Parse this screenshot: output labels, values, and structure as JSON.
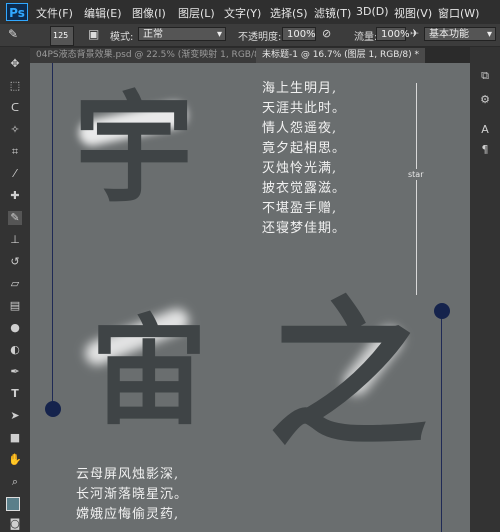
{
  "app": {
    "logo": "Ps"
  },
  "menu": [
    "文件(F)",
    "编辑(E)",
    "图像(I)",
    "图层(L)",
    "文字(Y)",
    "选择(S)",
    "滤镜(T)",
    "3D(D)",
    "视图(V)",
    "窗口(W)"
  ],
  "options": {
    "brush_size": "125",
    "mode_label": "模式:",
    "mode_value": "正常",
    "opacity_label": "不透明度:",
    "opacity_value": "100%",
    "flow_label": "流量:",
    "flow_value": "100%",
    "workspace": "基本功能"
  },
  "tabs": [
    {
      "label": "04PS液态背景效果.psd @ 22.5% (渐变映射 1, RGB/8) *",
      "active": false
    },
    {
      "label": "未标题-1 @ 16.7% (图层 1, RGB/8) *",
      "active": true
    }
  ],
  "canvas": {
    "big_chars": [
      "宇",
      "宙",
      "之"
    ],
    "poem_top": [
      "海上生明月,",
      "天涯共此时。",
      "情人怨遥夜,",
      "竟夕起相思。",
      "灭烛怜光满,",
      "披衣觉露滋。",
      "不堪盈手赠,",
      "还寝梦佳期。"
    ],
    "side_label": "star",
    "poem_bottom": [
      "云母屏风烛影深,",
      "长河渐落晓星沉。",
      "嫦娥应悔偷灵药,"
    ]
  },
  "colors": {
    "canvas_bg": "#6a6e6f",
    "dot": "#15234c",
    "accent_blue": "#31a8ff"
  },
  "icons": [
    "move-icon",
    "marquee-icon",
    "lasso-icon",
    "quick-select-icon",
    "crop-icon",
    "eyedropper-icon",
    "healing-icon",
    "brush-icon",
    "stamp-icon",
    "history-brush-icon",
    "eraser-icon",
    "gradient-icon",
    "blur-icon",
    "dodge-icon",
    "pen-icon",
    "type-icon",
    "path-select-icon",
    "shape-icon",
    "hand-icon",
    "zoom-icon"
  ]
}
